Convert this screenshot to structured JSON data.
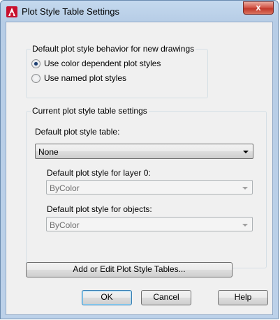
{
  "window": {
    "title": "Plot Style Table Settings",
    "close_label": "x"
  },
  "icons": {
    "app": "autocad-icon",
    "close": "close-icon",
    "dropdown": "chevron-down-icon"
  },
  "behavior_group": {
    "title": "Default plot style behavior for new drawings",
    "options": [
      {
        "label": "Use color dependent plot styles",
        "checked": true
      },
      {
        "label": "Use named plot styles",
        "checked": false
      }
    ]
  },
  "table_group": {
    "title": "Current plot style table settings",
    "default_table_label": "Default plot style table:",
    "default_table_value": "None",
    "layer0_label": "Default plot style for layer 0:",
    "layer0_value": "ByColor",
    "objects_label": "Default plot style for objects:",
    "objects_value": "ByColor"
  },
  "buttons": {
    "add_edit": "Add or Edit Plot Style Tables...",
    "ok": "OK",
    "cancel": "Cancel",
    "help": "Help"
  },
  "colors": {
    "accent_red": "#c2392b",
    "titlebar": "#bcd1e9",
    "client_bg": "#f0f0f0"
  }
}
